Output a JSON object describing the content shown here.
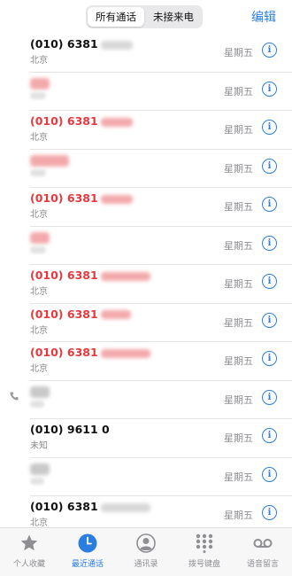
{
  "header": {
    "segment_all": "所有通话",
    "segment_missed": "未接来电",
    "edit": "编辑"
  },
  "calls": [
    {
      "number": "(010) 6381",
      "sub": "北京",
      "day": "星期五",
      "missed": false
    },
    {
      "number": "",
      "sub": "手机",
      "day": "星期五",
      "missed": true
    },
    {
      "number": "(010) 6381",
      "sub": "北京",
      "day": "星期五",
      "missed": true
    },
    {
      "number": "",
      "sub": "手机",
      "day": "星期五",
      "missed": true
    },
    {
      "number": "(010) 6381",
      "sub": "北京",
      "day": "星期五",
      "missed": true
    },
    {
      "number": "",
      "sub": "手机",
      "day": "星期五",
      "missed": true
    },
    {
      "number": "(010) 6381",
      "sub": "北京",
      "day": "星期五",
      "missed": true
    },
    {
      "number": "(010) 6381",
      "sub": "北京",
      "day": "星期五",
      "missed": true
    },
    {
      "number": "(010) 6381",
      "sub": "北京",
      "day": "星期五",
      "missed": true
    },
    {
      "number": "",
      "sub": "",
      "day": "星期五",
      "missed": false
    },
    {
      "number": "(010) 9611 0",
      "sub": "未知",
      "day": "星期五",
      "missed": false
    },
    {
      "number": "",
      "sub": "",
      "day": "星期五",
      "missed": false
    },
    {
      "number": "(010) 6381",
      "sub": "北京",
      "day": "星期五",
      "missed": false
    }
  ],
  "tabs": [
    {
      "label": "个人收藏",
      "icon": "star-icon"
    },
    {
      "label": "最近通话",
      "icon": "clock-icon"
    },
    {
      "label": "通讯录",
      "icon": "person-icon"
    },
    {
      "label": "拨号键盘",
      "icon": "keypad-icon"
    },
    {
      "label": "语音留言",
      "icon": "voicemail-icon"
    }
  ],
  "colors": {
    "accent": "#2a7de1",
    "missed": "#e8383d"
  }
}
